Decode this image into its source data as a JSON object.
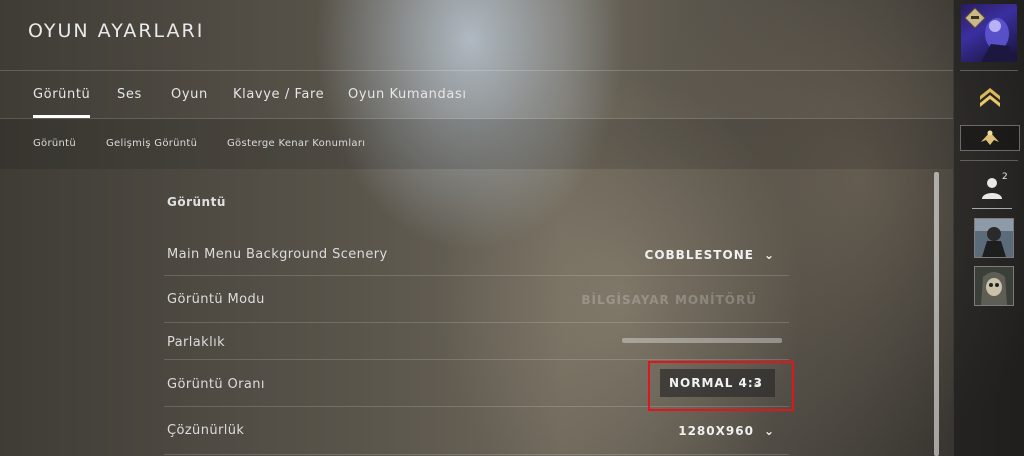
{
  "header": {
    "title": "OYUN AYARLARI"
  },
  "tabs": [
    {
      "label": "Görüntü"
    },
    {
      "label": "Ses"
    },
    {
      "label": "Oyun"
    },
    {
      "label": "Klavye / Fare"
    },
    {
      "label": "Oyun Kumandası"
    }
  ],
  "subtabs": [
    {
      "label": "Görüntü"
    },
    {
      "label": "Gelişmiş Görüntü"
    },
    {
      "label": "Gösterge Kenar Konumları"
    }
  ],
  "panel": {
    "section_title": "Görüntü",
    "rows": [
      {
        "label": "Main Menu Background Scenery",
        "value": "COBBLESTONE"
      },
      {
        "label": "Görüntü Modu",
        "value": "BİLGİSAYAR MONİTÖRÜ"
      },
      {
        "label": "Parlaklık"
      },
      {
        "label": "Görüntü Oranı",
        "value": "NORMAL 4:3"
      },
      {
        "label": "Çözünürlük",
        "value": "1280X960"
      }
    ]
  },
  "sidebar": {
    "friends_count": "2"
  },
  "colors": {
    "highlight": "#e0161c",
    "accent": "#ffffff"
  },
  "icons": [
    "chevron-down-icon",
    "rank-chevron-icon",
    "eagle-medal-icon",
    "person-icon"
  ]
}
